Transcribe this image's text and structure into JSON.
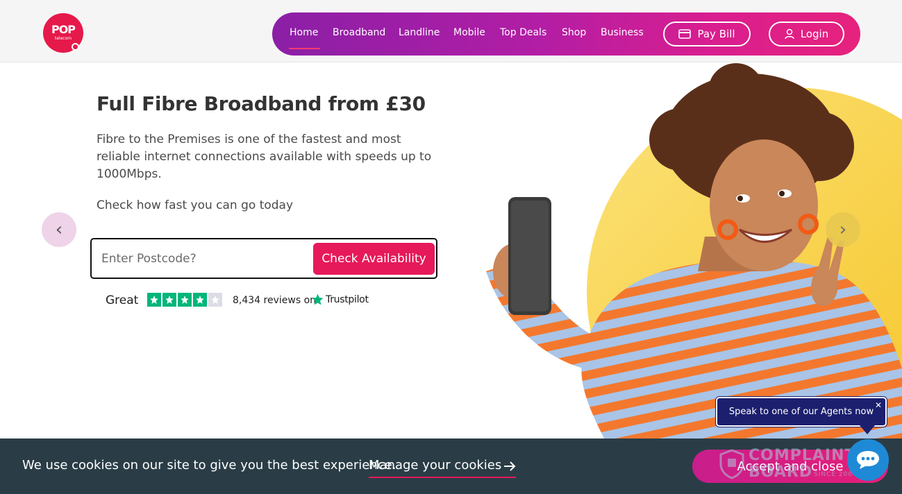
{
  "brand": {
    "logo_text": "POP",
    "logo_subtext": "telecom",
    "accent": "#e6195a"
  },
  "nav": {
    "items": [
      {
        "label": "Home",
        "active": true
      },
      {
        "label": "Broadband"
      },
      {
        "label": "Landline"
      },
      {
        "label": "Mobile"
      },
      {
        "label": "Top Deals"
      },
      {
        "label": "Shop"
      },
      {
        "label": "Business"
      }
    ],
    "pay_bill": {
      "label": "Pay Bill",
      "icon": "card-icon"
    },
    "login": {
      "label": "Login",
      "icon": "user-icon"
    }
  },
  "hero": {
    "title": "Full Fibre Broadband from £30",
    "description": "Fibre to the Premises is one of the fastest and most reliable internet connections available with speeds up to 1000Mbps.",
    "check_text": "Check how fast you can go today",
    "postcode_placeholder": "Enter Postcode?",
    "check_button": "Check Availability",
    "prev_arrow": "‹",
    "next_arrow": "›"
  },
  "trustpilot": {
    "rating_word": "Great",
    "stars_filled": 4,
    "stars_total": 5,
    "reviews_text": "8,434 reviews on",
    "brand": "Trustpilot"
  },
  "agent_prompt": {
    "text": "Speak to one of our Agents now",
    "close": "✕"
  },
  "cookie_bar": {
    "message": "We use cookies on our site to give you the best experience.",
    "manage_link": "Manage your cookies",
    "accept_button": "Accept and close"
  },
  "complaint_badge": {
    "title": "COMPLAINTS BOARD",
    "since": "SINCE 2004"
  }
}
